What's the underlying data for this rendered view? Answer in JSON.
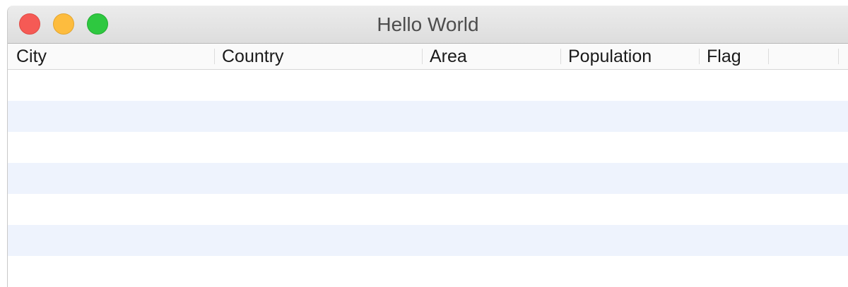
{
  "window": {
    "title": "Hello World"
  },
  "table": {
    "columns": [
      {
        "label": "City"
      },
      {
        "label": "Country"
      },
      {
        "label": "Area"
      },
      {
        "label": "Population"
      },
      {
        "label": "Flag"
      },
      {
        "label": ""
      }
    ],
    "rows": [],
    "stripe_color": "#eef3fd"
  },
  "colors": {
    "close": "#f55a55",
    "minimize": "#fdbc3e",
    "zoom": "#2ec840"
  },
  "icons": [
    "close-icon",
    "minimize-icon",
    "zoom-icon"
  ]
}
